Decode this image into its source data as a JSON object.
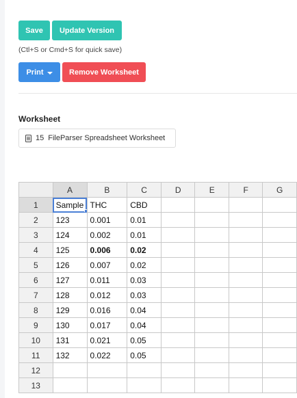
{
  "toolbar": {
    "save_label": "Save",
    "update_label": "Update Version",
    "quick_save_hint": "(Ctl+S or Cmd+S for quick save)",
    "print_label": "Print",
    "remove_label": "Remove Worksheet"
  },
  "worksheet": {
    "section_title": "Worksheet",
    "id": "15",
    "name": "FileParser Spreadsheet Worksheet",
    "icon": "document-icon"
  },
  "sheet": {
    "columns": [
      "A",
      "B",
      "C",
      "D",
      "E",
      "F",
      "G"
    ],
    "rows": [
      {
        "n": "1",
        "cells": [
          "Sample",
          "THC",
          "CBD",
          "",
          "",
          "",
          ""
        ]
      },
      {
        "n": "2",
        "cells": [
          "123",
          "0.001",
          "0.01",
          "",
          "",
          "",
          ""
        ]
      },
      {
        "n": "3",
        "cells": [
          "124",
          "0.002",
          "0.01",
          "",
          "",
          "",
          ""
        ]
      },
      {
        "n": "4",
        "cells": [
          "125",
          "0.006",
          "0.02",
          "",
          "",
          "",
          ""
        ],
        "bold": [
          1,
          2
        ]
      },
      {
        "n": "5",
        "cells": [
          "126",
          "0.007",
          "0.02",
          "",
          "",
          "",
          ""
        ]
      },
      {
        "n": "6",
        "cells": [
          "127",
          "0.011",
          "0.03",
          "",
          "",
          "",
          ""
        ]
      },
      {
        "n": "7",
        "cells": [
          "128",
          "0.012",
          "0.03",
          "",
          "",
          "",
          ""
        ]
      },
      {
        "n": "8",
        "cells": [
          "129",
          "0.016",
          "0.04",
          "",
          "",
          "",
          ""
        ]
      },
      {
        "n": "9",
        "cells": [
          "130",
          "0.017",
          "0.04",
          "",
          "",
          "",
          ""
        ]
      },
      {
        "n": "10",
        "cells": [
          "131",
          "0.021",
          "0.05",
          "",
          "",
          "",
          ""
        ]
      },
      {
        "n": "11",
        "cells": [
          "132",
          "0.022",
          "0.05",
          "",
          "",
          "",
          ""
        ]
      },
      {
        "n": "12",
        "cells": [
          "",
          "",
          "",
          "",
          "",
          "",
          ""
        ]
      },
      {
        "n": "13",
        "cells": [
          "",
          "",
          "",
          "",
          "",
          "",
          ""
        ]
      }
    ],
    "selected_cell": "A1"
  },
  "colors": {
    "teal": "#2fc4b2",
    "blue": "#3d8ee6",
    "red": "#f04e55",
    "selection": "#4a7fd6"
  }
}
